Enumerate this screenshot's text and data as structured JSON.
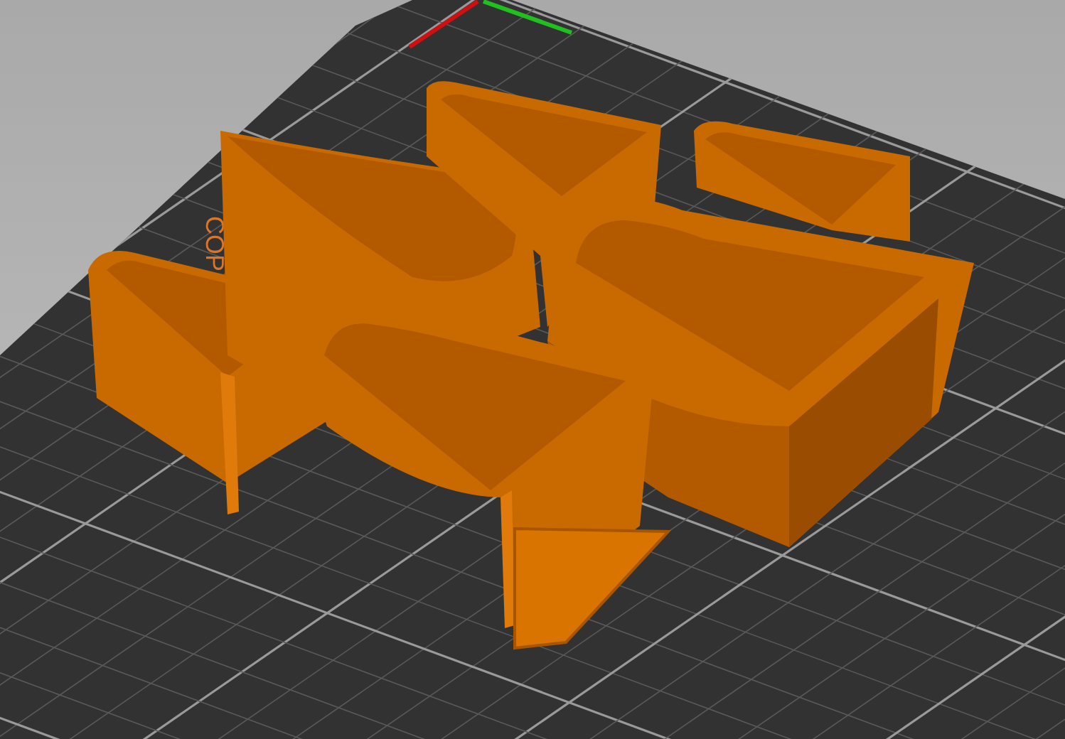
{
  "viewport": {
    "bed_label": "COP"
  }
}
